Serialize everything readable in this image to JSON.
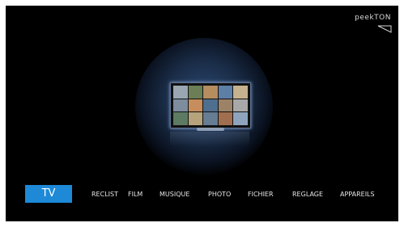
{
  "brand": {
    "logo_text": "peekTON"
  },
  "menu": {
    "items": [
      {
        "label": "TV",
        "active": true
      },
      {
        "label": "RECLIST",
        "active": false
      },
      {
        "label": "FILM",
        "active": false
      },
      {
        "label": "MUSIQUE",
        "active": false
      },
      {
        "label": "PHOTO",
        "active": false
      },
      {
        "label": "FICHIER",
        "active": false
      },
      {
        "label": "REGLAGE",
        "active": false
      },
      {
        "label": "APPAREILS",
        "active": false
      }
    ]
  },
  "colors": {
    "background": "#000000",
    "active_menu": "#1e89d7",
    "menu_text": "#e6e6e6"
  },
  "icons": {
    "hero": "tv-icon"
  }
}
